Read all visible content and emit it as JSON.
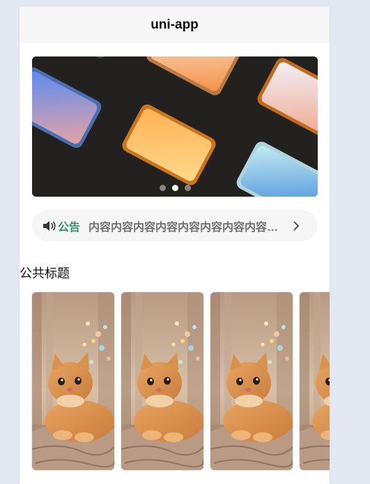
{
  "navbar": {
    "title": "uni-app"
  },
  "banner": {
    "image_icon": "phones-banner-image",
    "dot_count": 3,
    "active_dot": 1
  },
  "notice": {
    "icon": "speaker-icon",
    "tag": "公告",
    "text": "内容内容内容内容内容内容内容内容内容",
    "arrow_icon": "chevron-right-icon"
  },
  "section": {
    "title": "公共标题"
  },
  "cards": [
    {
      "image_icon": "cat-photo"
    },
    {
      "image_icon": "cat-photo"
    },
    {
      "image_icon": "cat-photo"
    },
    {
      "image_icon": "cat-photo"
    }
  ]
}
